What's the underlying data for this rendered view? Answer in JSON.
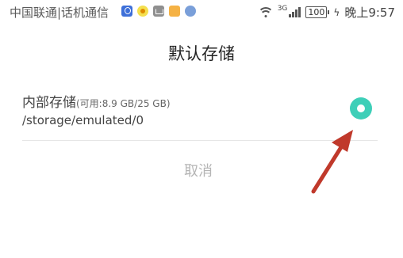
{
  "status_bar": {
    "carrier": "中国联通|话机通信",
    "net_type": "3G",
    "battery": "100",
    "time": "晚上9:57",
    "icons": [
      "bulb-app-icon",
      "sun-app-icon",
      "mail-app-icon",
      "orange-app-icon",
      "globe-app-icon",
      "wifi-icon",
      "signal-icon",
      "battery-icon",
      "charging-icon"
    ]
  },
  "dialog": {
    "title": "默认存储",
    "option": {
      "name": "内部存储",
      "capacity": "(可用:8.9 GB/25 GB)",
      "path": "/storage/emulated/0",
      "selected": true
    },
    "cancel_label": "取消"
  },
  "colors": {
    "accent": "#3ecfb8",
    "annotation_arrow": "#c0392b"
  }
}
